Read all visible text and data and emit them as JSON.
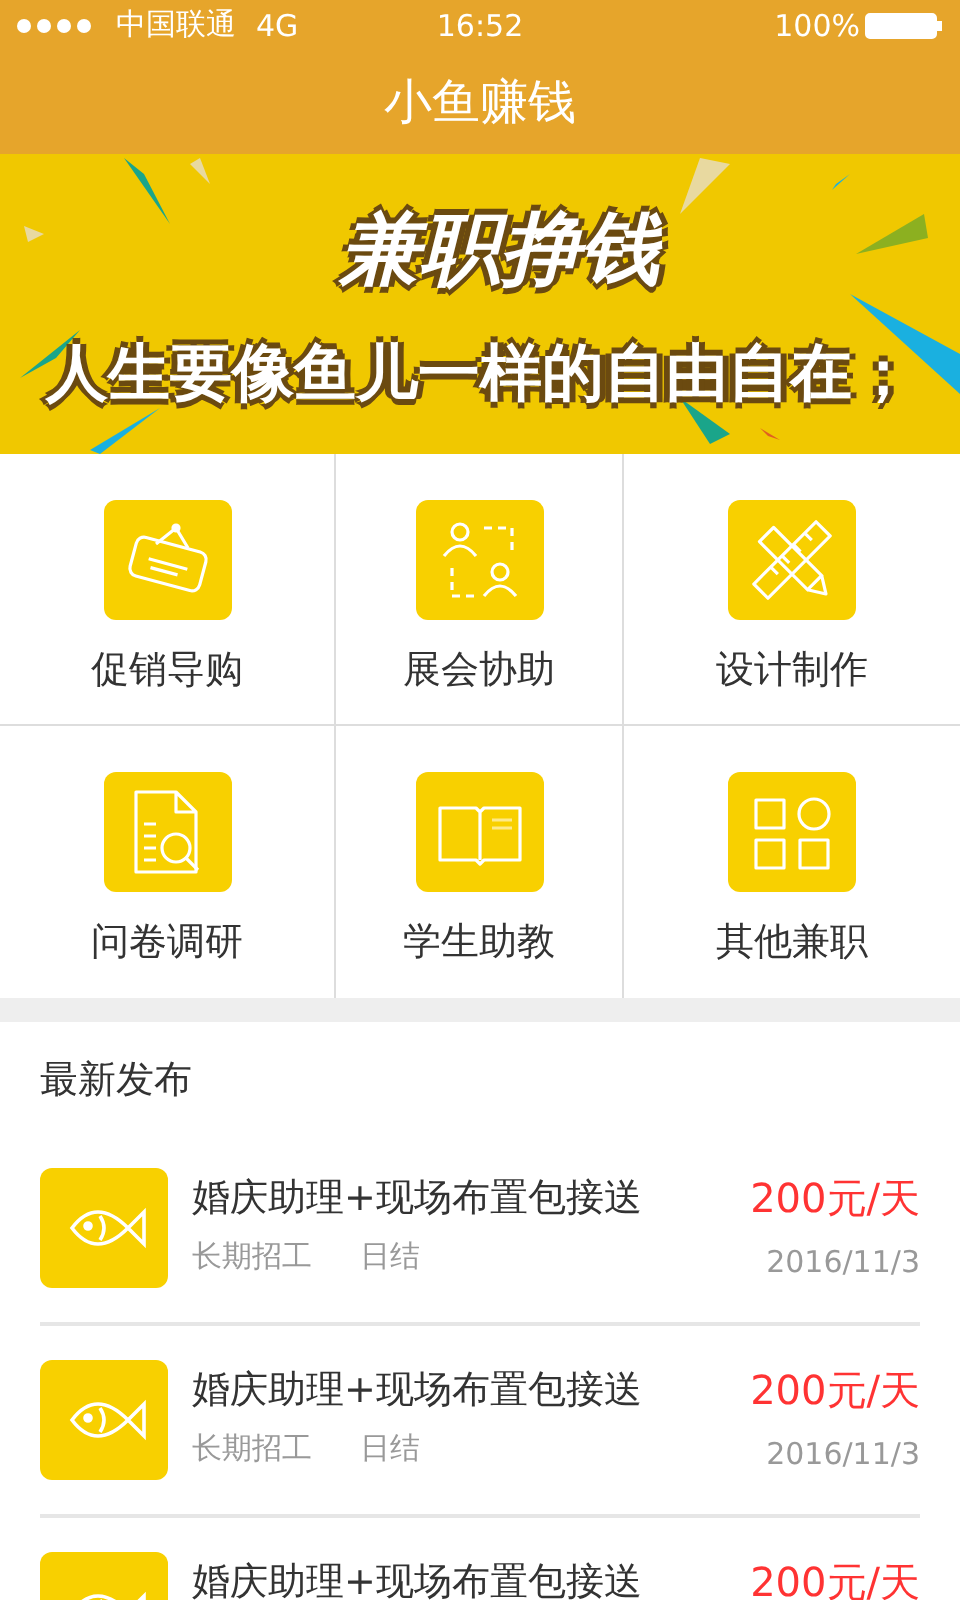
{
  "status_bar": {
    "carrier": "中国联通",
    "network": "4G",
    "time": "16:52",
    "battery": "100%"
  },
  "nav_bar": {
    "title": "小鱼赚钱"
  },
  "banner": {
    "headline": "兼职挣钱",
    "tagline": "人生要像鱼儿一样的自由自在；"
  },
  "categories": [
    {
      "label": "促销导购"
    },
    {
      "label": "展会协助"
    },
    {
      "label": "设计制作"
    },
    {
      "label": "问卷调研"
    },
    {
      "label": "学生助教"
    },
    {
      "label": "其他兼职"
    }
  ],
  "latest": {
    "heading": "最新发布",
    "jobs": [
      {
        "title": "婚庆助理+现场布置包接送",
        "pay": "200元/天",
        "tags": [
          "长期招工",
          "日结"
        ],
        "date": "2016/11/3"
      },
      {
        "title": "婚庆助理+现场布置包接送",
        "pay": "200元/天",
        "tags": [
          "长期招工",
          "日结"
        ],
        "date": "2016/11/3"
      },
      {
        "title": "婚庆助理+现场布置包接送",
        "pay": "200元/天"
      }
    ]
  }
}
